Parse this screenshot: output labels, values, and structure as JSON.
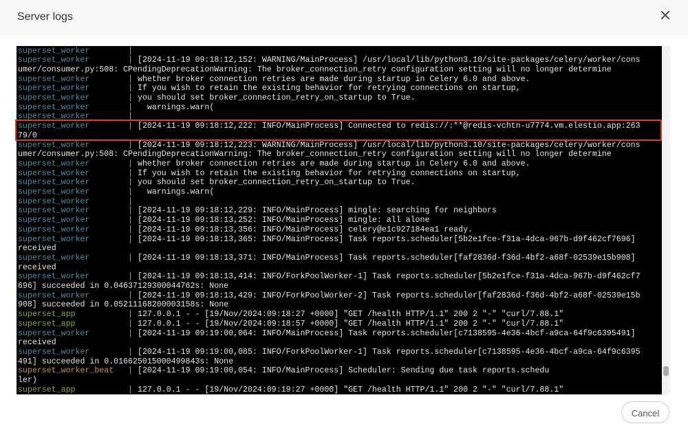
{
  "dialog": {
    "title": "Server logs",
    "close_glyph": "✕",
    "cancel_label": "Cancel"
  },
  "colors": {
    "superset_worker": "#4a90a4",
    "superset_app": "#8aa83a",
    "superset_worker_beat": "#c8963a",
    "highlight": "#e03a2a"
  },
  "log_lines": [
    {
      "svc": "superset_worker",
      "svc_key": "superset_worker",
      "bar": "|",
      "msg": ""
    },
    {
      "svc": "superset_worker",
      "svc_key": "superset_worker",
      "bar": "|",
      "msg": "[2024-11-19 09:18:12,152: WARNING/MainProcess] /usr/local/lib/python3.10/site-packages/celery/worker/cons"
    },
    {
      "svc": "",
      "svc_key": "",
      "bar": "",
      "msg": "umer/consumer.py:508: CPendingDeprecationWarning: The broker_connection_retry configuration setting will no longer determine"
    },
    {
      "svc": "superset_worker",
      "svc_key": "superset_worker",
      "bar": "|",
      "msg": "whether broker connection retries are made during startup in Celery 6.0 and above."
    },
    {
      "svc": "superset_worker",
      "svc_key": "superset_worker",
      "bar": "|",
      "msg": "If you wish to retain the existing behavior for retrying connections on startup,"
    },
    {
      "svc": "superset_worker",
      "svc_key": "superset_worker",
      "bar": "|",
      "msg": "you should set broker_connection_retry_on_startup to True."
    },
    {
      "svc": "superset_worker",
      "svc_key": "superset_worker",
      "bar": "|",
      "msg": "  warnings.warn("
    },
    {
      "svc": "superset_worker",
      "svc_key": "superset_worker",
      "bar": "|",
      "msg": ""
    },
    {
      "svc": "superset_worker",
      "svc_key": "superset_worker",
      "bar": "|",
      "msg": "[2024-11-19 09:18:12,222: INFO/MainProcess] Connected to redis://:**@redis-vchtn-u7774.vm.elestio.app:263"
    },
    {
      "svc": "",
      "svc_key": "",
      "bar": "",
      "msg": "79/0"
    },
    {
      "svc": "superset_worker",
      "svc_key": "superset_worker",
      "bar": "|",
      "msg": "[2024-11-19 09:18:12,223: WARNING/MainProcess] /usr/local/lib/python3.10/site-packages/celery/worker/cons"
    },
    {
      "svc": "",
      "svc_key": "",
      "bar": "",
      "msg": "umer/consumer.py:508: CPendingDeprecationWarning: The broker_connection_retry configuration setting will no longer determine"
    },
    {
      "svc": "superset_worker",
      "svc_key": "superset_worker",
      "bar": "|",
      "msg": "whether broker connection retries are made during startup in Celery 6.0 and above."
    },
    {
      "svc": "superset_worker",
      "svc_key": "superset_worker",
      "bar": "|",
      "msg": "If you wish to retain the existing behavior for retrying connections on startup,"
    },
    {
      "svc": "superset_worker",
      "svc_key": "superset_worker",
      "bar": "|",
      "msg": "you should set broker_connection_retry_on_startup to True."
    },
    {
      "svc": "superset_worker",
      "svc_key": "superset_worker",
      "bar": "|",
      "msg": "  warnings.warn("
    },
    {
      "svc": "superset_worker",
      "svc_key": "superset_worker",
      "bar": "|",
      "msg": ""
    },
    {
      "svc": "superset_worker",
      "svc_key": "superset_worker",
      "bar": "|",
      "msg": "[2024-11-19 09:18:12,229: INFO/MainProcess] mingle: searching for neighbors"
    },
    {
      "svc": "superset_worker",
      "svc_key": "superset_worker",
      "bar": "|",
      "msg": "[2024-11-19 09:18:13,252: INFO/MainProcess] mingle: all alone"
    },
    {
      "svc": "superset_worker",
      "svc_key": "superset_worker",
      "bar": "|",
      "msg": "[2024-11-19 09:18:13,356: INFO/MainProcess] celery@e1c927184ea1 ready."
    },
    {
      "svc": "superset_worker",
      "svc_key": "superset_worker",
      "bar": "|",
      "msg": "[2024-11-19 09:18:13,365: INFO/MainProcess] Task reports.scheduler[5b2e1fce-f31a-4dca-967b-d9f462cf7696]"
    },
    {
      "svc": "",
      "svc_key": "",
      "bar": "",
      "msg": "received"
    },
    {
      "svc": "superset_worker",
      "svc_key": "superset_worker",
      "bar": "|",
      "msg": "[2024-11-19 09:18:13,371: INFO/MainProcess] Task reports.scheduler[faf2836d-f36d-4bf2-a68f-02539e15b908]"
    },
    {
      "svc": "",
      "svc_key": "",
      "bar": "",
      "msg": "received"
    },
    {
      "svc": "superset_worker",
      "svc_key": "superset_worker",
      "bar": "|",
      "msg": "[2024-11-19 09:18:13,414: INFO/ForkPoolWorker-1] Task reports.scheduler[5b2e1fce-f31a-4dca-967b-d9f462cf7"
    },
    {
      "svc": "",
      "svc_key": "",
      "bar": "",
      "msg": "696] succeeded in 0.04637129300044762s: None"
    },
    {
      "svc": "superset_worker",
      "svc_key": "superset_worker",
      "bar": "|",
      "msg": "[2024-11-19 09:18:13,429: INFO/ForkPoolWorker-2] Task reports.scheduler[faf2836d-f36d-4bf2-a68f-02539e15b"
    },
    {
      "svc": "",
      "svc_key": "",
      "bar": "",
      "msg": "908] succeeded in 0.05211168200003158s: None"
    },
    {
      "svc": "superset_app",
      "svc_key": "superset_app",
      "bar": "|",
      "msg": "127.0.0.1 - - [19/Nov/2024:09:18:27 +0000] \"GET /health HTTP/1.1\" 200 2 \"-\" \"curl/7.88.1\""
    },
    {
      "svc": "superset_app",
      "svc_key": "superset_app",
      "bar": "|",
      "msg": "127.0.0.1 - - [19/Nov/2024:09:18:57 +0000] \"GET /health HTTP/1.1\" 200 2 \"-\" \"curl/7.88.1\""
    },
    {
      "svc": "superset_worker",
      "svc_key": "superset_worker",
      "bar": "|",
      "msg": "[2024-11-19 09:19:00,064: INFO/MainProcess] Task reports.scheduler[c7138595-4e36-4bcf-a9ca-64f9c6395491]"
    },
    {
      "svc": "",
      "svc_key": "",
      "bar": "",
      "msg": "received"
    },
    {
      "svc": "superset_worker",
      "svc_key": "superset_worker",
      "bar": "|",
      "msg": "[2024-11-19 09:19:00,085: INFO/ForkPoolWorker-1] Task reports.scheduler[c7138595-4e36-4bcf-a9ca-64f9c6395"
    },
    {
      "svc": "",
      "svc_key": "",
      "bar": "",
      "msg": "491] succeeded in 0.016625015000499843s: None"
    },
    {
      "svc": "superset_worker_beat",
      "svc_key": "superset_worker_beat",
      "bar": "|",
      "msg": "[2024-11-19 09:19:00,054: INFO/MainProcess] Scheduler: Sending due task reports.schedu"
    },
    {
      "svc": "",
      "svc_key": "",
      "bar": "",
      "msg": "ler)"
    },
    {
      "svc": "superset_app",
      "svc_key": "superset_app",
      "bar": "|",
      "msg": "127.0.0.1 - - [19/Nov/2024:09:19:27 +0000] \"GET /health HTTP/1.1\" 200 2 \"-\" \"curl/7.88.1\""
    }
  ]
}
